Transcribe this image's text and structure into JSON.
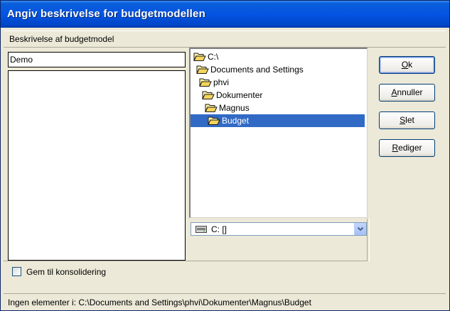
{
  "window": {
    "title": "Angiv beskrivelse for budgetmodellen"
  },
  "subheader": {
    "label": "Beskrivelse af budgetmodel"
  },
  "form": {
    "description_value": "Demo",
    "memo_value": ""
  },
  "tree": {
    "items": [
      {
        "label": "C:\\",
        "level": 0,
        "selected": false,
        "open": true
      },
      {
        "label": "Documents and Settings",
        "level": 1,
        "selected": false,
        "open": true
      },
      {
        "label": "phvi",
        "level": 2,
        "selected": false,
        "open": true
      },
      {
        "label": "Dokumenter",
        "level": 3,
        "selected": false,
        "open": true
      },
      {
        "label": "Magnus",
        "level": 4,
        "selected": false,
        "open": true
      },
      {
        "label": "Budget",
        "level": 5,
        "selected": true,
        "open": true
      }
    ]
  },
  "drive": {
    "selected": "C: []"
  },
  "buttons": {
    "ok": {
      "accel": "O",
      "rest": "k"
    },
    "cancel": {
      "accel": "A",
      "rest": "nnuller"
    },
    "delete": {
      "accel": "S",
      "rest": "let"
    },
    "edit": {
      "accel": "R",
      "rest": "ediger"
    }
  },
  "options": {
    "consolidate_label": "Gem til konsolidering",
    "consolidate_checked": false
  },
  "status": {
    "text": "Ingen elementer i: C:\\Documents and Settings\\phvi\\Dokumenter\\Magnus\\Budget"
  },
  "colors": {
    "title_bar": "#0554e3",
    "selection": "#316ac5",
    "face": "#ece9d8"
  }
}
